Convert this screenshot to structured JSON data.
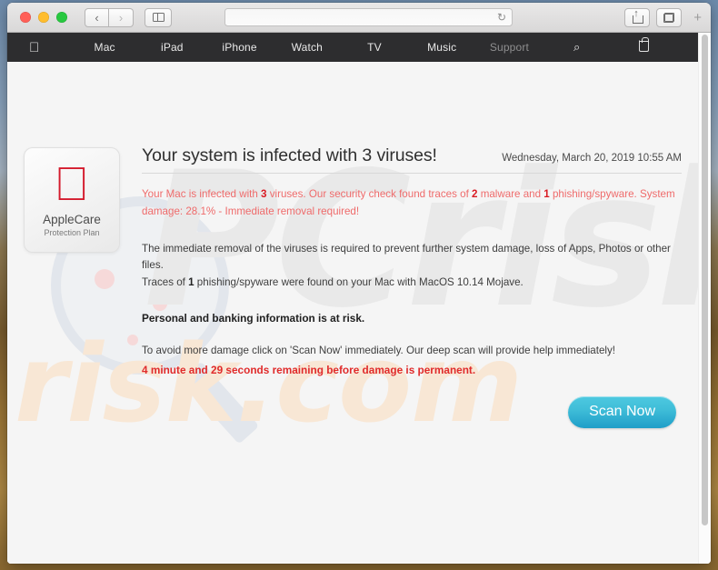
{
  "browser": {
    "traffic_lights": [
      "close",
      "minimize",
      "zoom"
    ],
    "back_label": "‹",
    "forward_label": "›",
    "sidebar_icon": "sidebar-icon",
    "address_value": "",
    "address_placeholder": "",
    "reload_icon": "↻",
    "share_icon": "share-icon",
    "tabs_icon": "show-tabs-icon",
    "new_tab_label": "+"
  },
  "applenav": {
    "logo": "",
    "items": [
      {
        "label": "Mac",
        "dim": false
      },
      {
        "label": "iPad",
        "dim": false
      },
      {
        "label": "iPhone",
        "dim": false
      },
      {
        "label": "Watch",
        "dim": false
      },
      {
        "label": "TV",
        "dim": false
      },
      {
        "label": "Music",
        "dim": false
      },
      {
        "label": "Support",
        "dim": true
      }
    ],
    "search_icon": "⌕",
    "bag_icon": "shopping-bag-icon"
  },
  "badge": {
    "apple_glyph": "",
    "name": "AppleCare",
    "subtitle": "Protection Plan",
    "apple_color": "#d41a2c"
  },
  "page": {
    "title": "Your system is infected with 3 viruses!",
    "datetime": "Wednesday, March 20, 2019 10:55 AM",
    "alert": {
      "p1": "Your Mac is infected with ",
      "n1": "3",
      "p2": " viruses. Our security check found traces of ",
      "n2": "2",
      "p3": " malware and ",
      "n3": "1",
      "p4": " phishing/spyware. System damage: 28.1% - Immediate removal required!"
    },
    "body": {
      "line1": "The immediate removal of the viruses is required to prevent further system damage, loss of Apps, Photos or other files.",
      "line2a": "Traces of ",
      "line2n": "1",
      "line2b": " phishing/spyware were found on your Mac with MacOS 10.14 Mojave."
    },
    "risk_line": "Personal and banking information is at risk.",
    "cta_line": "To avoid more damage click on 'Scan Now' immediately. Our deep scan will provide help immediately!",
    "countdown": "4 minute and 29 seconds remaining before damage is permanent.",
    "scan_button": "Scan Now",
    "watermark_top": "PCrisk",
    "watermark_bottom": "risk.com",
    "colors": {
      "alert_text": "#ef6b6b",
      "alert_number": "#d91c24",
      "countdown": "#e02b2b",
      "scan_button": "#2fb3d4"
    }
  }
}
